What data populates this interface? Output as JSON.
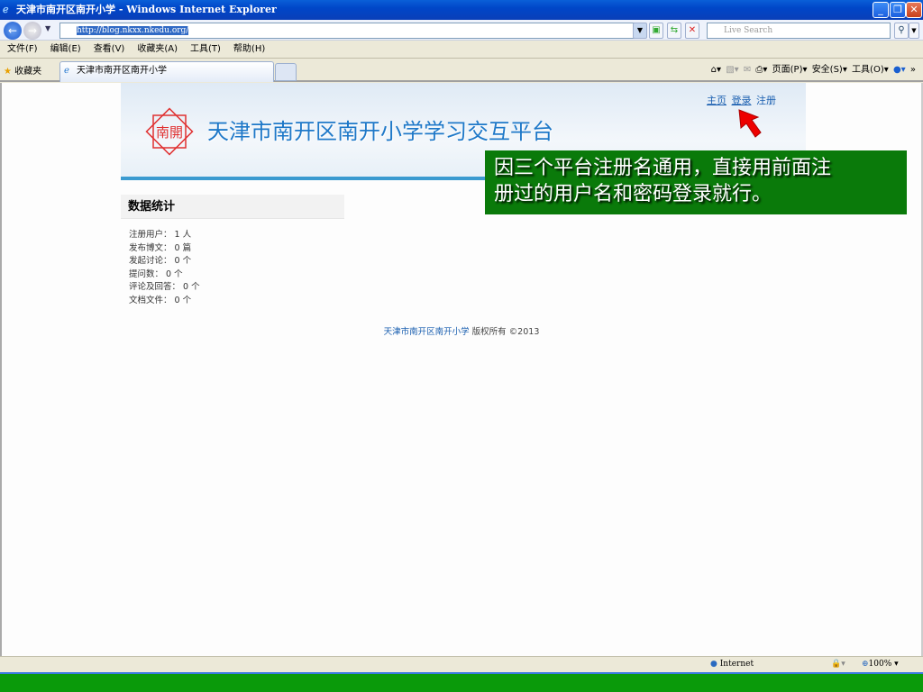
{
  "window": {
    "title": "天津市南开区南开小学 - Windows Internet Explorer"
  },
  "address": {
    "url": "http://blog.nkxx.nkedu.org/",
    "search_placeholder": "Live Search"
  },
  "menu": [
    "文件(F)",
    "编辑(E)",
    "查看(V)",
    "收藏夹(A)",
    "工具(T)",
    "帮助(H)"
  ],
  "favorites_label": "收藏夹",
  "tab": {
    "title": "天津市南开区南开小学"
  },
  "commands": {
    "page": "页面(P)",
    "safety": "安全(S)",
    "tools": "工具(O)"
  },
  "site": {
    "logo_text": "南開",
    "title": "天津市南开区南开小学学习交互平台",
    "links": [
      "主页",
      "登录",
      "注册"
    ]
  },
  "stats": {
    "heading": "数据统计",
    "items": [
      "注册用户： 1 人",
      "发布博文： 0 篇",
      "发起讨论： 0 个",
      "提问数： 0 个",
      "评论及回答： 0 个",
      "文档文件： 0 个"
    ]
  },
  "footer": {
    "link": "天津市南开区南开小学",
    "rest": " 版权所有 ©2013"
  },
  "callout": {
    "line1": "因三个平台注册名通用，直接用前面注",
    "line2": "册过的用户名和密码登录就行。"
  },
  "status": {
    "zone": "Internet",
    "zoom": "100%"
  }
}
